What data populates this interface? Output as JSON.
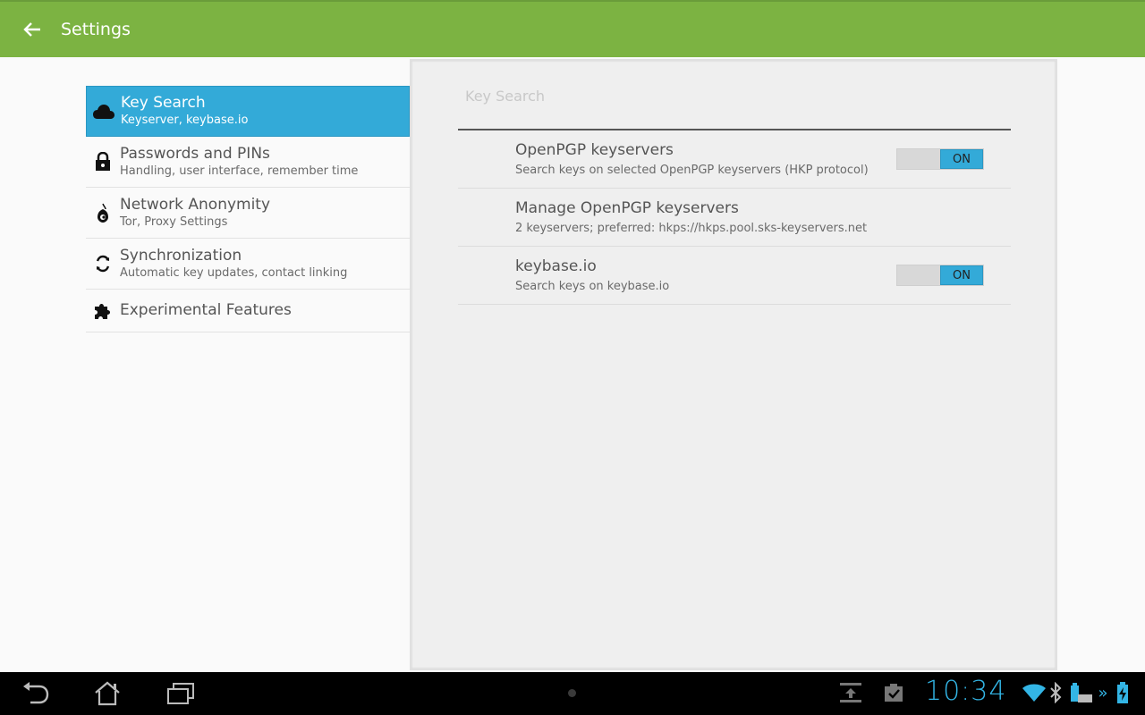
{
  "app": {
    "title": "Settings"
  },
  "headers": [
    {
      "icon": "cloud-icon",
      "title": "Key Search",
      "summary": "Keyserver, keybase.io",
      "selected": true
    },
    {
      "icon": "lock-icon",
      "title": "Passwords and PINs",
      "summary": "Handling, user interface, remember time",
      "selected": false
    },
    {
      "icon": "onion-icon",
      "title": "Network Anonymity",
      "summary": "Tor, Proxy Settings",
      "selected": false
    },
    {
      "icon": "sync-icon",
      "title": "Synchronization",
      "summary": "Automatic key updates, contact linking",
      "selected": false
    },
    {
      "icon": "puzzle-icon",
      "title": "Experimental Features",
      "summary": "",
      "selected": false
    }
  ],
  "detail": {
    "category": "Key Search",
    "prefs": [
      {
        "title": "OpenPGP keyservers",
        "summary": "Search keys on selected OpenPGP keyservers (HKP protocol)",
        "switch": "ON"
      },
      {
        "title": "Manage OpenPGP keyservers",
        "summary": "2 keyservers; preferred: hkps://hkps.pool.sks-keyservers.net"
      },
      {
        "title": "keybase.io",
        "summary": "Search keys on keybase.io",
        "switch": "ON"
      }
    ]
  },
  "statusbar": {
    "time": "10:34"
  },
  "colors": {
    "actionbar": "#7cb342",
    "accent": "#33aad8",
    "clock": "#33b5e5"
  }
}
